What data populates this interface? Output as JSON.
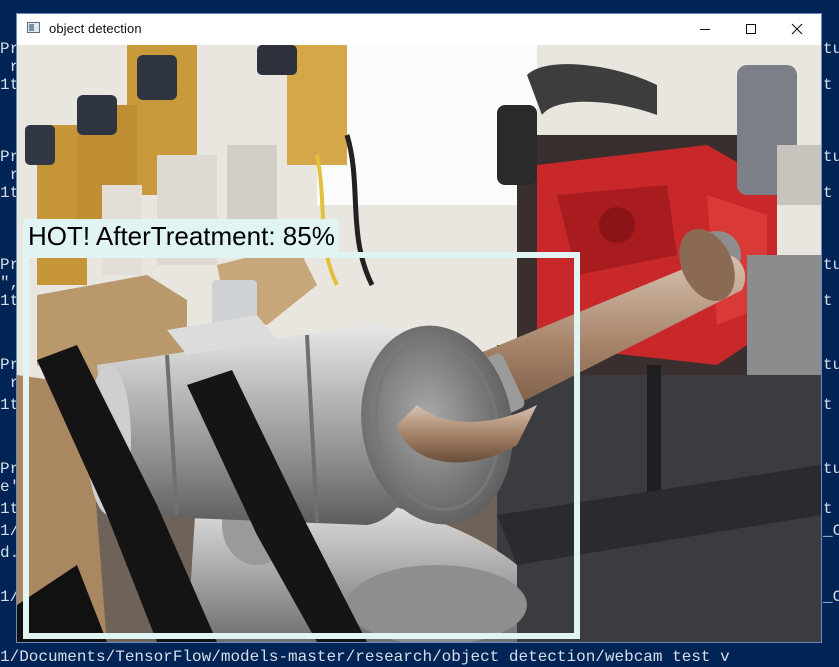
{
  "console": {
    "left_lines": [
      "Pr",
      " r",
      "1t",
      "Pr",
      " r",
      "1t",
      "Pr",
      "\",",
      "1t",
      "Pr",
      " r",
      "1t",
      "Pr",
      "e'",
      "1t",
      "1/",
      "d.",
      "1/"
    ],
    "right_lines": [
      "tu",
      "t v",
      "tu",
      "t v",
      "tu",
      "t v",
      "tu",
      "t v",
      "tu",
      "t v",
      "_C",
      "_C"
    ],
    "bottom_line": "1/Documents/TensorFlow/models-master/research/object detection/webcam test v"
  },
  "window": {
    "title": "object detection",
    "controls": {
      "minimize": "minimize-icon",
      "maximize": "maximize-icon",
      "close": "close-icon"
    }
  },
  "detection": {
    "label": "HOT! AfterTreatment: 85%",
    "class_name": "AfterTreatment",
    "score_percent": 85,
    "box_color": "#dff4f3"
  },
  "colors": {
    "console_bg": "#012456",
    "engine_red": "#c8282a"
  }
}
